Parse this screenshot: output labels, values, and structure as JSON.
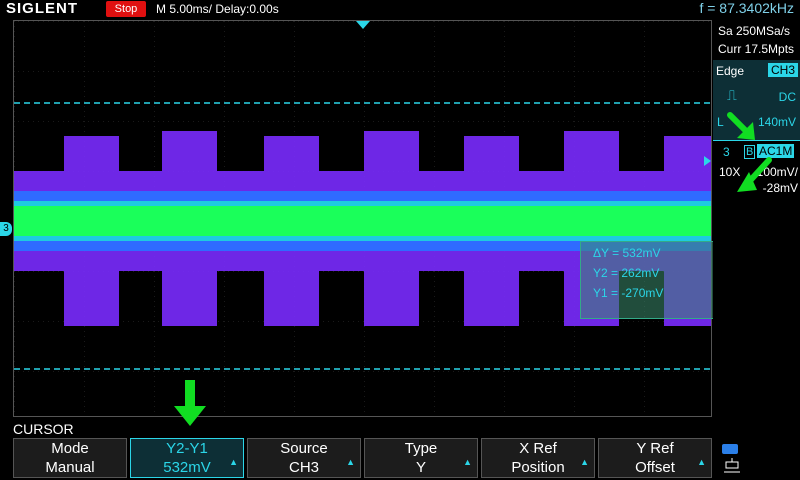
{
  "header": {
    "brand": "SIGLENT",
    "run_state": "Stop",
    "timebase": "M 5.00ms/ Delay:0.00s",
    "frequency": "f = 87.3402kHz"
  },
  "acquisition": {
    "sample_rate": "Sa 250MSa/s",
    "memory": "Curr 17.5Mpts"
  },
  "trigger": {
    "type": "Edge",
    "source": "CH3",
    "coupling": "DC",
    "level_label": "L",
    "level": "140mV"
  },
  "channel": {
    "number": "3",
    "bw_limit": "B",
    "coupling": "AC1M",
    "probe": "10X",
    "volts_div": "100mV/",
    "offset": "-28mV",
    "marker": "3"
  },
  "cursor_readout": {
    "delta": "ΔY = 532mV",
    "y2": "Y2 = 262mV",
    "y1": "Y1 = -270mV"
  },
  "section_title": "CURSOR",
  "menu": [
    {
      "top": "Mode",
      "bottom": "Manual"
    },
    {
      "top": "Y2-Y1",
      "bottom": "532mV"
    },
    {
      "top": "Source",
      "bottom": "CH3"
    },
    {
      "top": "Type",
      "bottom": "Y"
    },
    {
      "top": "X Ref",
      "bottom": "Position"
    },
    {
      "top": "Y Ref",
      "bottom": "Offset"
    }
  ],
  "colors": {
    "accent": "#2bd6e8",
    "stop": "#e01010",
    "trace_core": "#1aff5a",
    "trace_outer": "#8a3cff"
  }
}
